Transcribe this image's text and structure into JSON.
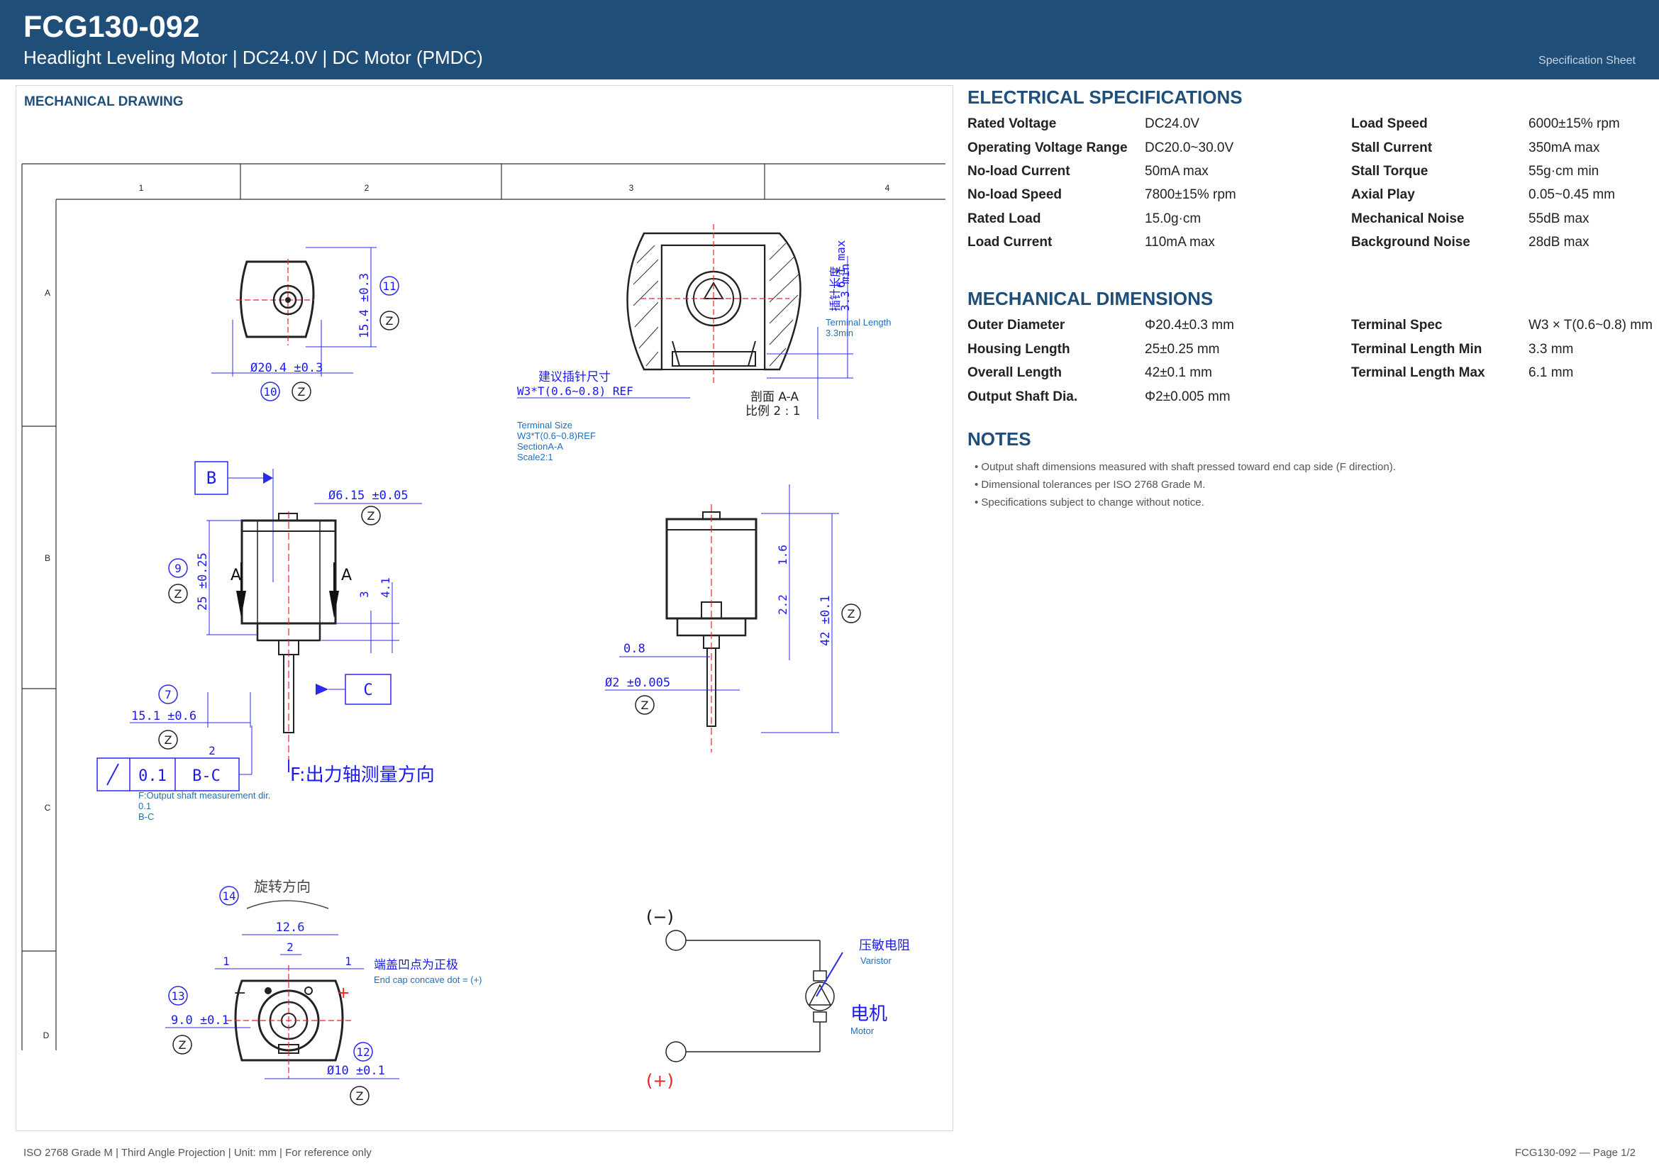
{
  "header": {
    "part_number": "FCG130-092",
    "subtitle": "Headlight Leveling Motor  |  DC24.0V  |  DC Motor (PMDC)",
    "sheet_label": "Specification Sheet"
  },
  "drawing": {
    "title": "MECHANICAL DRAWING",
    "zone_columns": [
      "1",
      "2",
      "3",
      "4"
    ],
    "zone_rows": [
      "A",
      "B",
      "C",
      "D"
    ],
    "front_view": {
      "dia": "Ø20.4 ±0.3",
      "height": "15.4 ±0.3",
      "balloon_a": "10",
      "balloon_b": "11",
      "z": "Z"
    },
    "section_view": {
      "terminal_length_cn": "插针长度",
      "terminal_min": "3.3 min",
      "terminal_max": "6.1 max",
      "terminal_label_en": "Terminal Length",
      "terminal_label_en2": "3.3min",
      "suggest_cn": "建议插针尺寸",
      "w3_ref": "W3*T(0.6∼0.8) REF",
      "section_cn": "剖面 A-A",
      "scale_cn": "比例 2 : 1",
      "en_1": "Terminal Size",
      "en_2": "W3*T(0.6~0.8)REF",
      "en_3": "SectionA-A",
      "en_4": "Scale2:1"
    },
    "side_view": {
      "datum_b": "B",
      "datum_c": "C",
      "section_mark": "A",
      "dia_shaft": "Ø6.15 ±0.05",
      "length": "25 ±0.25",
      "dim_3": "3",
      "dim_41": "4.1",
      "shaft_len": "15.1 ±0.6",
      "balloon_9": "9",
      "balloon_7": "7",
      "tol_value": "0.1",
      "tol_datum": "B-C",
      "tol_sup": "2",
      "f_cn": "F:出力轴测量方向",
      "f_en": "F:Output shaft measurement dir.",
      "f_en2": "0.1",
      "f_en3": "B-C"
    },
    "right_view": {
      "dim_16": "1.6",
      "dim_22": "2.2",
      "dim_42": "42 ±0.1",
      "dim_08": "0.8",
      "dia_out": "Ø2 ±0.005"
    },
    "end_view": {
      "balloon_14": "14",
      "rotation_cn": "旋转方向",
      "dim_126": "12.6",
      "dim_2": "2",
      "dim_1": "1",
      "cn_dot": "端盖凹点为正极",
      "en_dot": "End cap concave dot = (+)",
      "balloon_13": "13",
      "dim_90": "9.0 ±0.1",
      "balloon_12": "12",
      "dim_10": "Ø10 ±0.1"
    },
    "circuit": {
      "neg": "(−)",
      "pos": "(+)",
      "varistor_cn": "压敏电阻",
      "varistor_en": "Varistor",
      "motor_cn": "电机",
      "motor_en": "Motor"
    }
  },
  "electrical": {
    "title": "ELECTRICAL SPECIFICATIONS",
    "left": [
      {
        "label": "Rated Voltage",
        "value": "DC24.0V"
      },
      {
        "label": "Operating Voltage Range",
        "value": "DC20.0~30.0V"
      },
      {
        "label": "No-load Current",
        "value": "50mA max"
      },
      {
        "label": "No-load Speed",
        "value": "7800±15% rpm"
      },
      {
        "label": "Rated Load",
        "value": "15.0g·cm"
      },
      {
        "label": "Load Current",
        "value": "110mA max"
      }
    ],
    "right": [
      {
        "label": "Load Speed",
        "value": "6000±15% rpm"
      },
      {
        "label": "Stall Current",
        "value": "350mA max"
      },
      {
        "label": "Stall Torque",
        "value": "55g·cm min"
      },
      {
        "label": "Axial Play",
        "value": "0.05~0.45 mm"
      },
      {
        "label": "Mechanical Noise",
        "value": "55dB max"
      },
      {
        "label": "Background Noise",
        "value": "28dB max"
      }
    ]
  },
  "mechanical": {
    "title": "MECHANICAL DIMENSIONS",
    "left": [
      {
        "label": "Outer Diameter",
        "value": "Φ20.4±0.3 mm"
      },
      {
        "label": "Housing Length",
        "value": "25±0.25 mm"
      },
      {
        "label": "Overall Length",
        "value": "42±0.1 mm"
      },
      {
        "label": "Output Shaft Dia.",
        "value": "Φ2±0.005 mm"
      }
    ],
    "right": [
      {
        "label": "Terminal Spec",
        "value": "W3 × T(0.6~0.8) mm"
      },
      {
        "label": "Terminal Length Min",
        "value": "3.3 mm"
      },
      {
        "label": "Terminal Length Max",
        "value": "6.1 mm"
      }
    ]
  },
  "notes": {
    "title": "NOTES",
    "items": [
      "• Output shaft dimensions measured with shaft pressed toward end cap side (F direction).",
      "• Dimensional tolerances per ISO 2768 Grade M.",
      "• Specifications subject to change without notice."
    ]
  },
  "footer": {
    "left": "ISO 2768 Grade M  |  Third Angle Projection  |  Unit: mm  |  For reference only",
    "right": "FCG130-092  —  Page 1/2"
  }
}
